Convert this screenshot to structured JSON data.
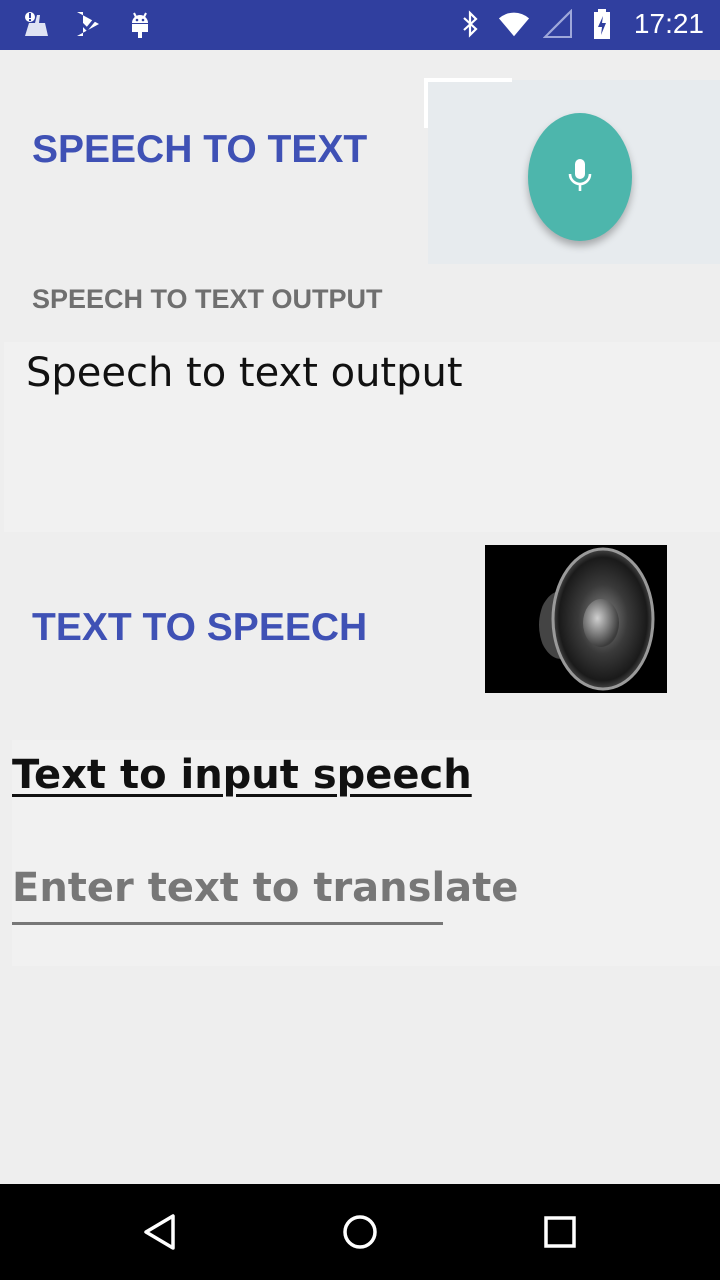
{
  "status_bar": {
    "time": "17:21",
    "left_icons": [
      "cleaner-notification-icon",
      "task-notification-icon",
      "android-debug-icon"
    ],
    "right_icons": [
      "bluetooth-icon",
      "wifi-icon",
      "signal-icon",
      "battery-charging-icon"
    ]
  },
  "speech_to_text": {
    "title": "SPEECH TO TEXT",
    "mic_button_icon": "mic-icon",
    "mic_button_color": "#4db6ac",
    "output_label": "SPEECH TO TEXT OUTPUT",
    "output_text": "Speech to text output"
  },
  "text_to_speech": {
    "title": "TEXT TO SPEECH",
    "speaker_button_icon": "speaker-icon",
    "input_heading": "Text to input speech",
    "input_placeholder": "Enter text to translate",
    "input_value": ""
  },
  "nav_bar": {
    "icons": [
      "back-icon",
      "home-icon",
      "recents-icon"
    ]
  },
  "colors": {
    "accent": "#3f51b5",
    "status_bar": "#303f9f",
    "background": "#eeeeee"
  }
}
